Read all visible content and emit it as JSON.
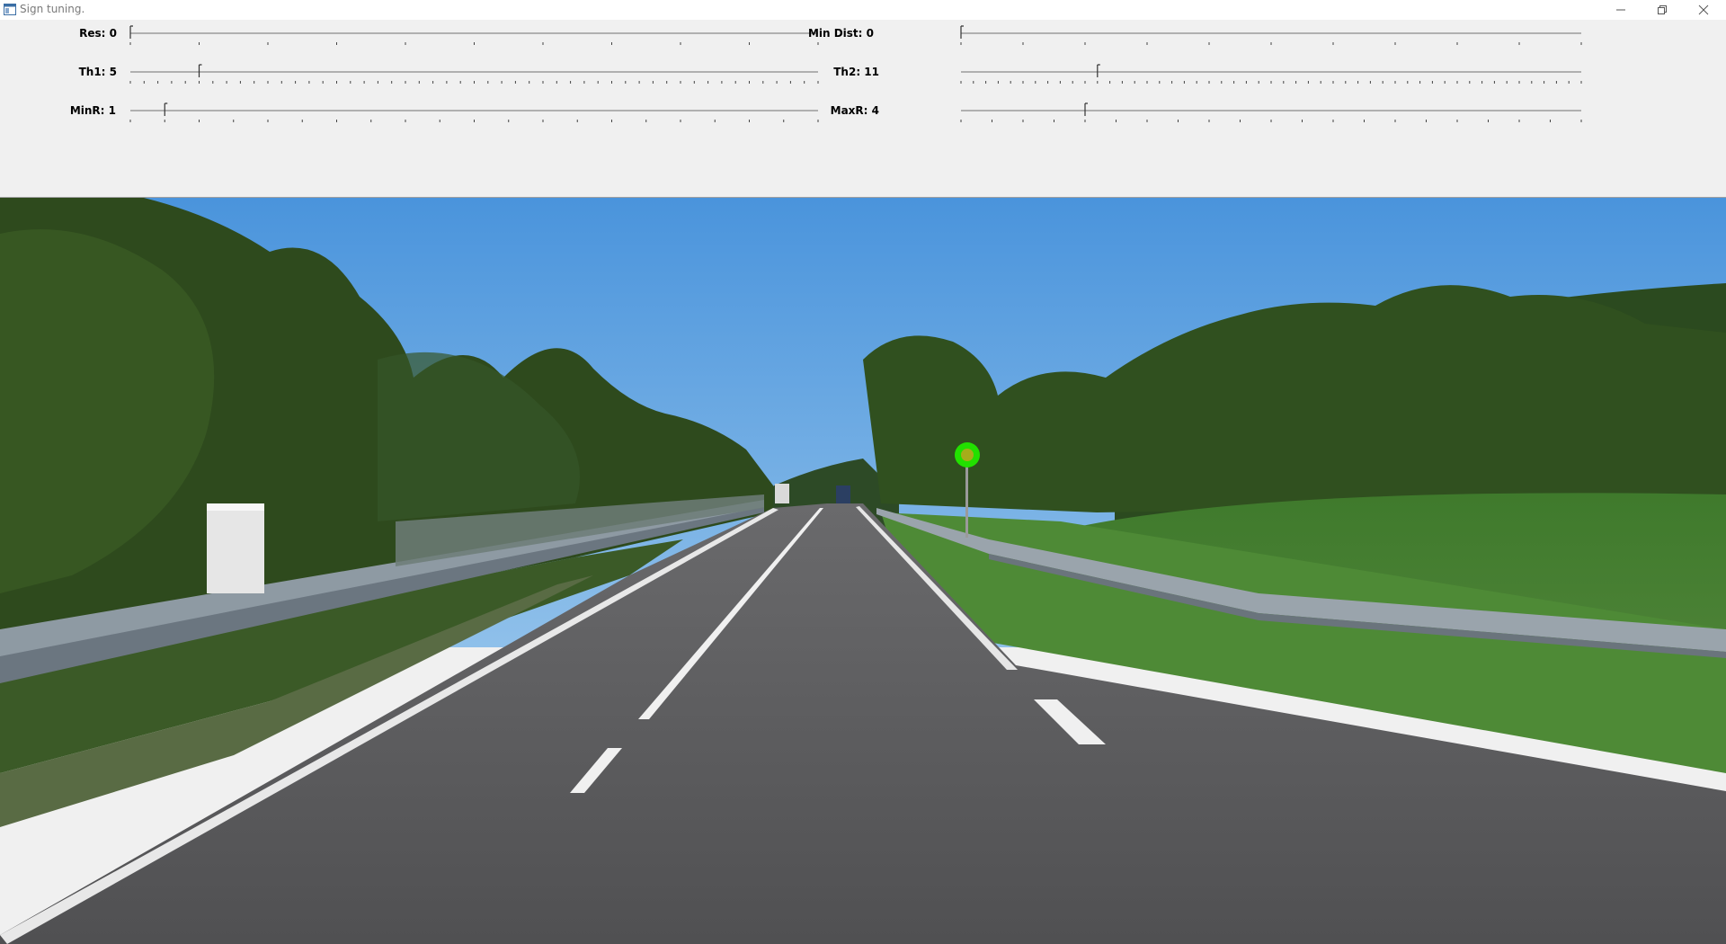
{
  "window": {
    "title": "Sign tuning."
  },
  "window_buttons": {
    "minimize_icon": "minimize-icon",
    "restore_icon": "restore-icon",
    "close_icon": "close-icon"
  },
  "trackbars": [
    {
      "id": "res",
      "label": "Res: 0",
      "value": 0,
      "max": 10
    },
    {
      "id": "min-dist",
      "label": "Min Dist: 0",
      "value": 0,
      "max": 10
    },
    {
      "id": "th1",
      "label": "Th1: 5",
      "value": 5,
      "max": 50
    },
    {
      "id": "th2",
      "label": "Th2: 11",
      "value": 11,
      "max": 50
    },
    {
      "id": "minr",
      "label": "MinR: 1",
      "value": 1,
      "max": 20
    },
    {
      "id": "maxr",
      "label": "MaxR: 4",
      "value": 4,
      "max": 20
    }
  ],
  "colors": {
    "sky": "#5ba3e6",
    "detected_circle": "#22e000",
    "road": "#5a5a5c",
    "grass": "#4f7d32",
    "trees": "#2f4a1c"
  },
  "image": {
    "description_icon": "road-scene-image"
  }
}
